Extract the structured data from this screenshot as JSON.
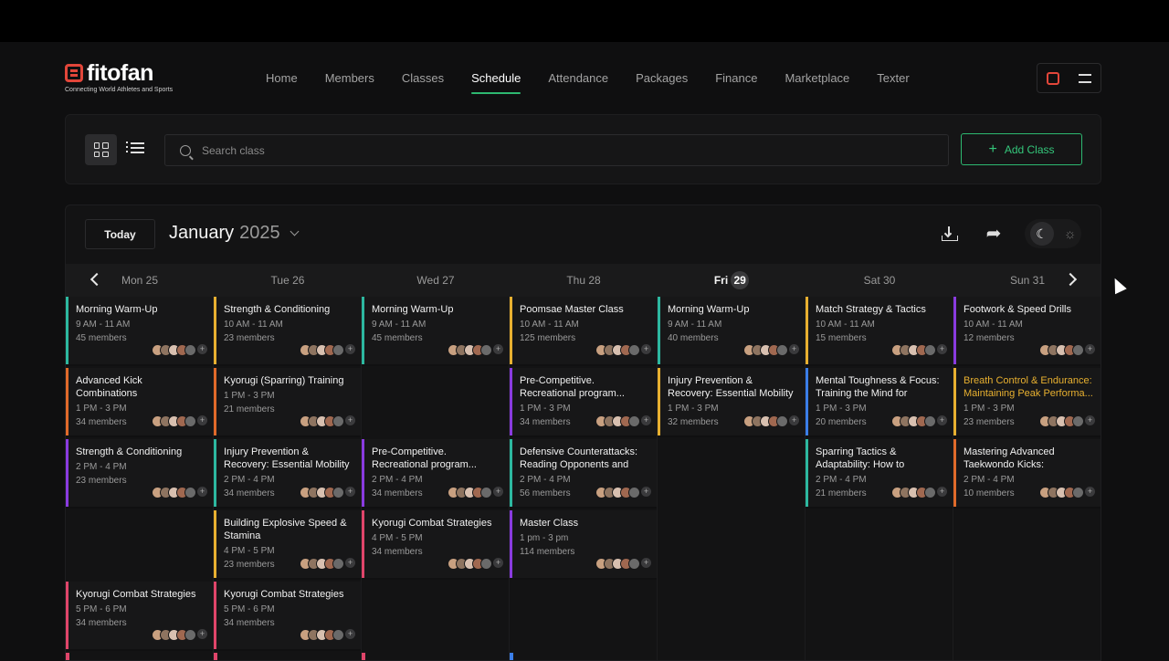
{
  "brand": {
    "name": "fitofan",
    "tagline": "Connecting World Athletes and Sports",
    "accent": "#2db870",
    "logo_color": "#e2463a"
  },
  "nav": [
    {
      "label": "Home"
    },
    {
      "label": "Members"
    },
    {
      "label": "Classes"
    },
    {
      "label": "Schedule",
      "active": true
    },
    {
      "label": "Attendance"
    },
    {
      "label": "Packages"
    },
    {
      "label": "Finance"
    },
    {
      "label": "Marketplace"
    },
    {
      "label": "Texter"
    }
  ],
  "toolbar": {
    "search_placeholder": "Search class",
    "add_label": "Add Class"
  },
  "calendar": {
    "today_label": "Today",
    "month": "January",
    "year": "2025",
    "days": [
      {
        "label": "Mon 25"
      },
      {
        "label": "Tue 26"
      },
      {
        "label": "Wed 27"
      },
      {
        "label": "Thu 28"
      },
      {
        "label": "Fri",
        "num": "29",
        "today": true
      },
      {
        "label": "Sat 30"
      },
      {
        "label": "Sun 31"
      }
    ],
    "columns": [
      [
        {
          "title": "Morning Warm-Up",
          "time": "9 AM - 11 AM",
          "members": "45 members",
          "color": "#2db8a0",
          "slot": 0
        },
        {
          "title": "Advanced Kick Combinations",
          "time": "1 PM - 3 PM",
          "members": "34 members",
          "color": "#e06a2a",
          "slot": 1
        },
        {
          "title": "Strength & Conditioning",
          "time": "2 PM - 4 PM",
          "members": "23 members",
          "color": "#8a3be0",
          "slot": 2
        },
        {
          "title": "Kyorugi Combat Strategies",
          "time": "5 PM - 6 PM",
          "members": "34 members",
          "color": "#e0456a",
          "slot": 4
        }
      ],
      [
        {
          "title": "Strength & Conditioning",
          "time": "10 AM - 11 AM",
          "members": "23 members",
          "color": "#e8b030",
          "slot": 0
        },
        {
          "title": "Kyorugi (Sparring) Training",
          "time": "1 PM - 3 PM",
          "members": "21 members",
          "color": "#e06a2a",
          "slot": 1
        },
        {
          "title": "Injury Prevention & Recovery: Essential Mobility and Stretc...",
          "time": "2 PM - 4 PM",
          "members": "34 members",
          "color": "#2db8a0",
          "slot": 2
        },
        {
          "title": "Building Explosive Speed & Stamina",
          "time": "4 PM - 5 PM",
          "members": "23 members",
          "color": "#e8b030",
          "slot": 3
        },
        {
          "title": "Kyorugi Combat Strategies",
          "time": "5 PM - 6 PM",
          "members": "34 members",
          "color": "#e0456a",
          "slot": 4
        }
      ],
      [
        {
          "title": "Morning Warm-Up",
          "time": "9 AM - 11 AM",
          "members": "45 members",
          "color": "#2db8a0",
          "slot": 0
        },
        {
          "title": "Pre-Competitive. Recreational program...",
          "time": "2 PM - 4 PM",
          "members": "34 members",
          "color": "#8a3be0",
          "slot": 2
        },
        {
          "title": "Kyorugi Combat Strategies",
          "time": "4 PM - 5 PM",
          "members": "34 members",
          "color": "#e0456a",
          "slot": 3
        }
      ],
      [
        {
          "title": "Poomsae Master Class",
          "time": "10 AM - 11 AM",
          "members": "125 members",
          "color": "#e8b030",
          "slot": 0
        },
        {
          "title": "Pre-Competitive. Recreational program...",
          "time": "1 PM - 3 PM",
          "members": "34 members",
          "color": "#8a3be0",
          "slot": 1
        },
        {
          "title": "Defensive Counterattacks: Reading Opponents and Rea...",
          "time": "2 PM - 4 PM",
          "members": "56 members",
          "color": "#2db8a0",
          "slot": 2
        },
        {
          "title": "Master Class",
          "time": "1 pm - 3 pm",
          "members": "114 members",
          "color": "#8a3be0",
          "slot": 3
        }
      ],
      [
        {
          "title": "Morning Warm-Up",
          "time": "9 AM - 11 AM",
          "members": "40 members",
          "color": "#2db8a0",
          "slot": 0
        },
        {
          "title": "Injury Prevention & Recovery: Essential Mobility and Stretc...",
          "time": "1 PM - 3 PM",
          "members": "32 members",
          "color": "#e8b030",
          "slot": 1
        }
      ],
      [
        {
          "title": "Match Strategy & Tactics",
          "time": "10 AM - 11 AM",
          "members": "15 members",
          "color": "#e8b030",
          "slot": 0
        },
        {
          "title": "Mental Toughness & Focus: Training the Mind for Compe...",
          "time": "1 PM - 3 PM",
          "members": "20 members",
          "color": "#3b7ee8",
          "slot": 1
        },
        {
          "title": "Sparring Tactics & Adaptability: How to Domina...",
          "time": "2 PM - 4 PM",
          "members": "21 members",
          "color": "#2db8a0",
          "slot": 2
        }
      ],
      [
        {
          "title": "Footwork & Speed Drills",
          "time": "10 AM - 11 AM",
          "members": "12 members",
          "color": "#8a3be0",
          "slot": 0
        },
        {
          "title": "Breath Control & Endurance: Maintaining Peak Performa...",
          "time": "1 PM - 3 PM",
          "members": "23 members",
          "color": "#e8b030",
          "slot": 1,
          "highlight": true
        },
        {
          "title": "Mastering Advanced Taekwondo Kicks: Precision,...",
          "time": "2 PM - 4 PM",
          "members": "10 members",
          "color": "#e06a2a",
          "slot": 2
        }
      ]
    ],
    "peek_colors": [
      "#e0456a",
      "#e0456a",
      "#e0456a",
      "#3b7ee8"
    ]
  }
}
